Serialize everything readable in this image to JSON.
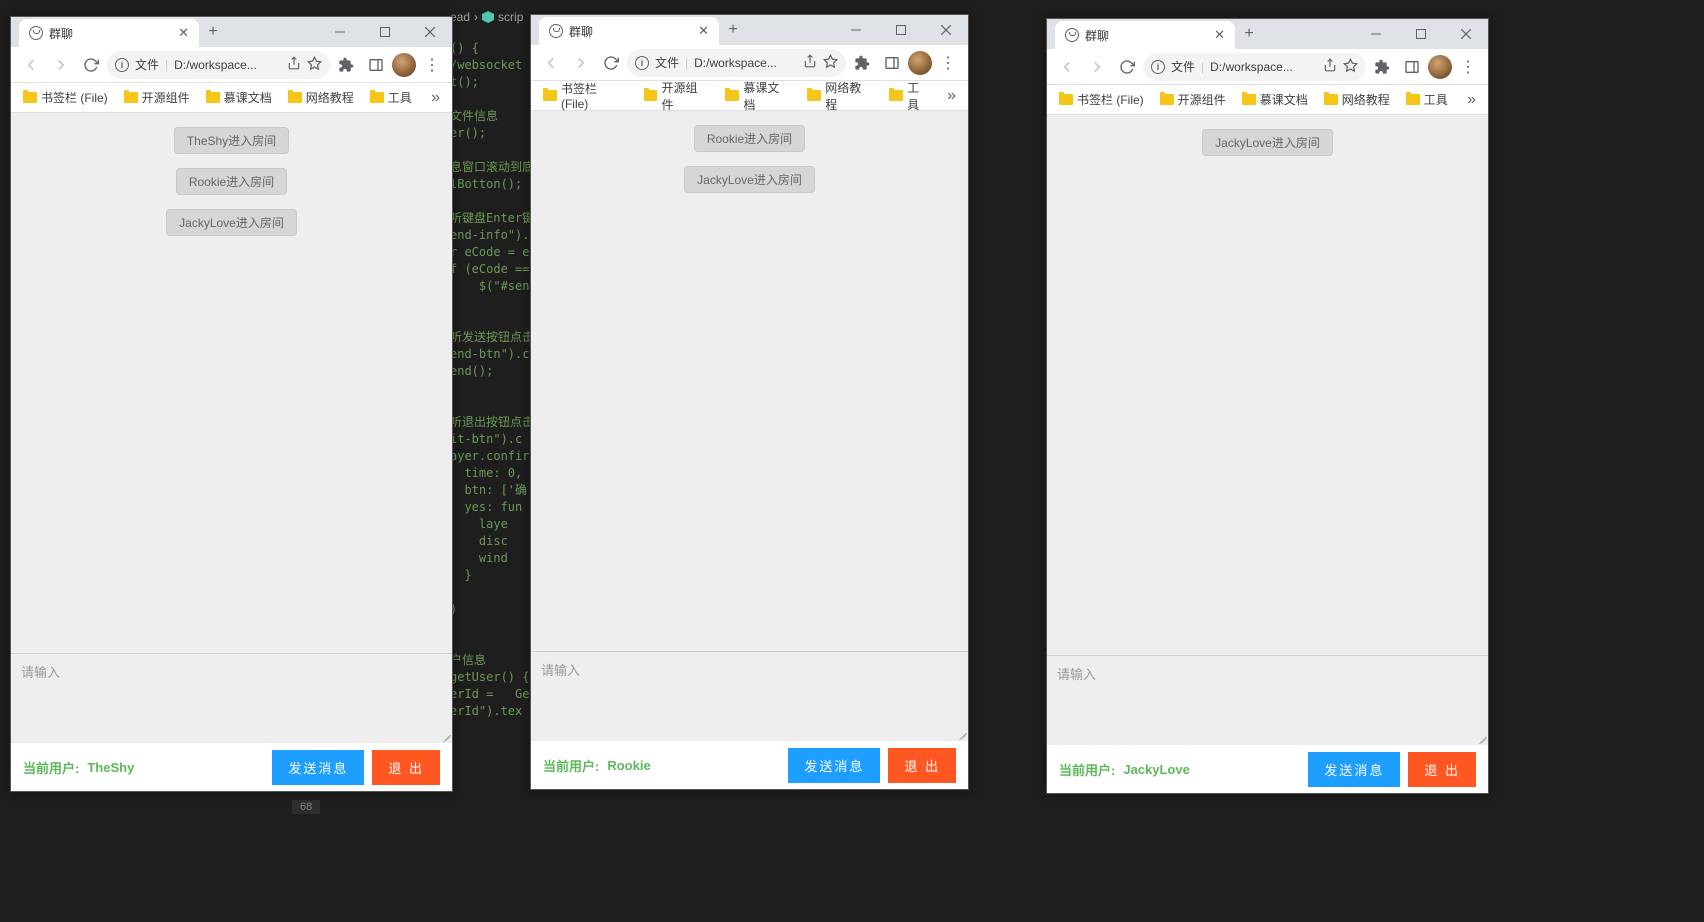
{
  "breadcrumb": {
    "p1": "ead",
    "sep": "›",
    "p2": "scrip"
  },
  "code_snippets": [
    "() {",
    "/websocket",
    "t();",
    "",
    "文件信息",
    "er();",
    "",
    "息窗口滚动到底",
    "lBotton();",
    "",
    "听键盘Enter键",
    "end-info\").",
    "r eCode = e",
    "f (eCode ==",
    "    $(\"#send",
    "",
    "",
    "听发送按钮点击",
    "end-btn\").c",
    "end();",
    "",
    "",
    "听退出按钮点击",
    "it-btn\").c",
    "ayer.confir",
    "  time: 0,",
    "  btn: ['确",
    "  yes: fun",
    "    laye",
    "    disc",
    "    wind",
    "  }",
    "",
    ")",
    "",
    "",
    "户信息",
    "getUser() {",
    "erId =   Ge",
    "erId\").tex"
  ],
  "line_number": "68",
  "windows": [
    {
      "tab_title": "群聊",
      "url_prefix": "文件",
      "url_path": "D:/workspace...",
      "bookmarks": [
        "书签栏 (File)",
        "开源组件",
        "慕课文档",
        "网络教程",
        "工具"
      ],
      "messages": [
        "TheShy进入房间",
        "Rookie进入房间",
        "JackyLove进入房间"
      ],
      "input_placeholder": "请输入",
      "current_user_label": "当前用户:",
      "current_user": "TheShy",
      "send_label": "发送消息",
      "exit_label": "退 出"
    },
    {
      "tab_title": "群聊",
      "url_prefix": "文件",
      "url_path": "D:/workspace...",
      "bookmarks": [
        "书签栏 (File)",
        "开源组件",
        "慕课文档",
        "网络教程",
        "工具"
      ],
      "messages": [
        "Rookie进入房间",
        "JackyLove进入房间"
      ],
      "input_placeholder": "请输入",
      "current_user_label": "当前用户:",
      "current_user": "Rookie",
      "send_label": "发送消息",
      "exit_label": "退 出"
    },
    {
      "tab_title": "群聊",
      "url_prefix": "文件",
      "url_path": "D:/workspace...",
      "bookmarks": [
        "书签栏 (File)",
        "开源组件",
        "慕课文档",
        "网络教程",
        "工具"
      ],
      "messages": [
        "JackyLove进入房间"
      ],
      "input_placeholder": "请输入",
      "current_user_label": "当前用户:",
      "current_user": "JackyLove",
      "send_label": "发送消息",
      "exit_label": "退 出"
    }
  ]
}
